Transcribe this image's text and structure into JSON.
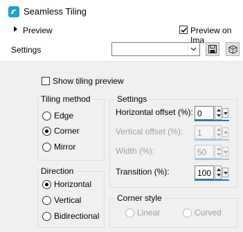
{
  "window": {
    "title": "Seamless Tiling"
  },
  "preview": {
    "label": "Preview",
    "preview_on_image_label": "Preview on Ima",
    "preview_on_image_checked": true
  },
  "settings_bar": {
    "label": "Settings",
    "preset_value": ""
  },
  "show_tiling_preview": {
    "label": "Show tiling preview",
    "checked": false
  },
  "tiling_method": {
    "title": "Tiling method",
    "options": [
      {
        "label": "Edge",
        "selected": false
      },
      {
        "label": "Corner",
        "selected": true
      },
      {
        "label": "Mirror",
        "selected": false
      }
    ]
  },
  "direction": {
    "title": "Direction",
    "options": [
      {
        "label": "Horizontal",
        "selected": true
      },
      {
        "label": "Vertical",
        "selected": false
      },
      {
        "label": "Bidirectional",
        "selected": false
      }
    ]
  },
  "settings_group": {
    "title": "Settings",
    "fields": [
      {
        "label": "Horizontal offset (%):",
        "value": "0",
        "enabled": true
      },
      {
        "label": "Vertical offset (%):",
        "value": "1",
        "enabled": false
      },
      {
        "label": "Width (%):",
        "value": "50",
        "enabled": false
      },
      {
        "label": "Transition (%):",
        "value": "100",
        "enabled": true
      }
    ]
  },
  "corner_style": {
    "title": "Corner style",
    "options": [
      {
        "label": "Linear",
        "selected": false,
        "enabled": false
      },
      {
        "label": "Curved",
        "selected": false,
        "enabled": false
      }
    ]
  },
  "colors": {
    "accent": "#1e74d0",
    "icon_teal": "#1aa4c8",
    "panel_bg": "#f0f0f0"
  }
}
